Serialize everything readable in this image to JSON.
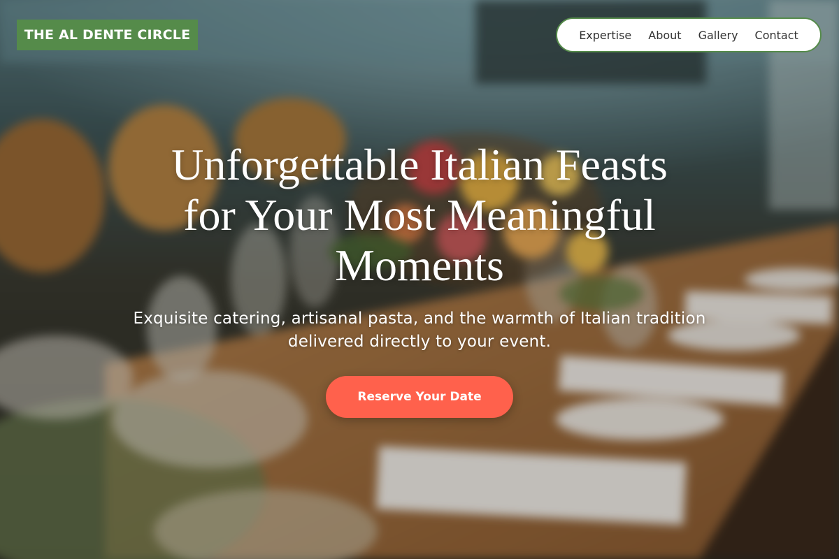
{
  "brand": {
    "name": "THE AL DENTE CIRCLE",
    "color": "#558b4a"
  },
  "nav": {
    "items": [
      "Expertise",
      "About",
      "Gallery",
      "Contact"
    ],
    "border_color": "#558b4a"
  },
  "hero": {
    "title_line1": "Unforgettable Italian Feasts",
    "title_line2": "for Your Most Meaningful",
    "title_line3": "Moments",
    "subtitle_line1": "Exquisite catering, artisanal pasta, and the warmth of Italian tradition",
    "subtitle_line2": "delivered directly to your event.",
    "cta_label": "Reserve Your Date",
    "cta_color": "#ff614c"
  },
  "background": {
    "description_icon": "banquet-table-photo"
  }
}
